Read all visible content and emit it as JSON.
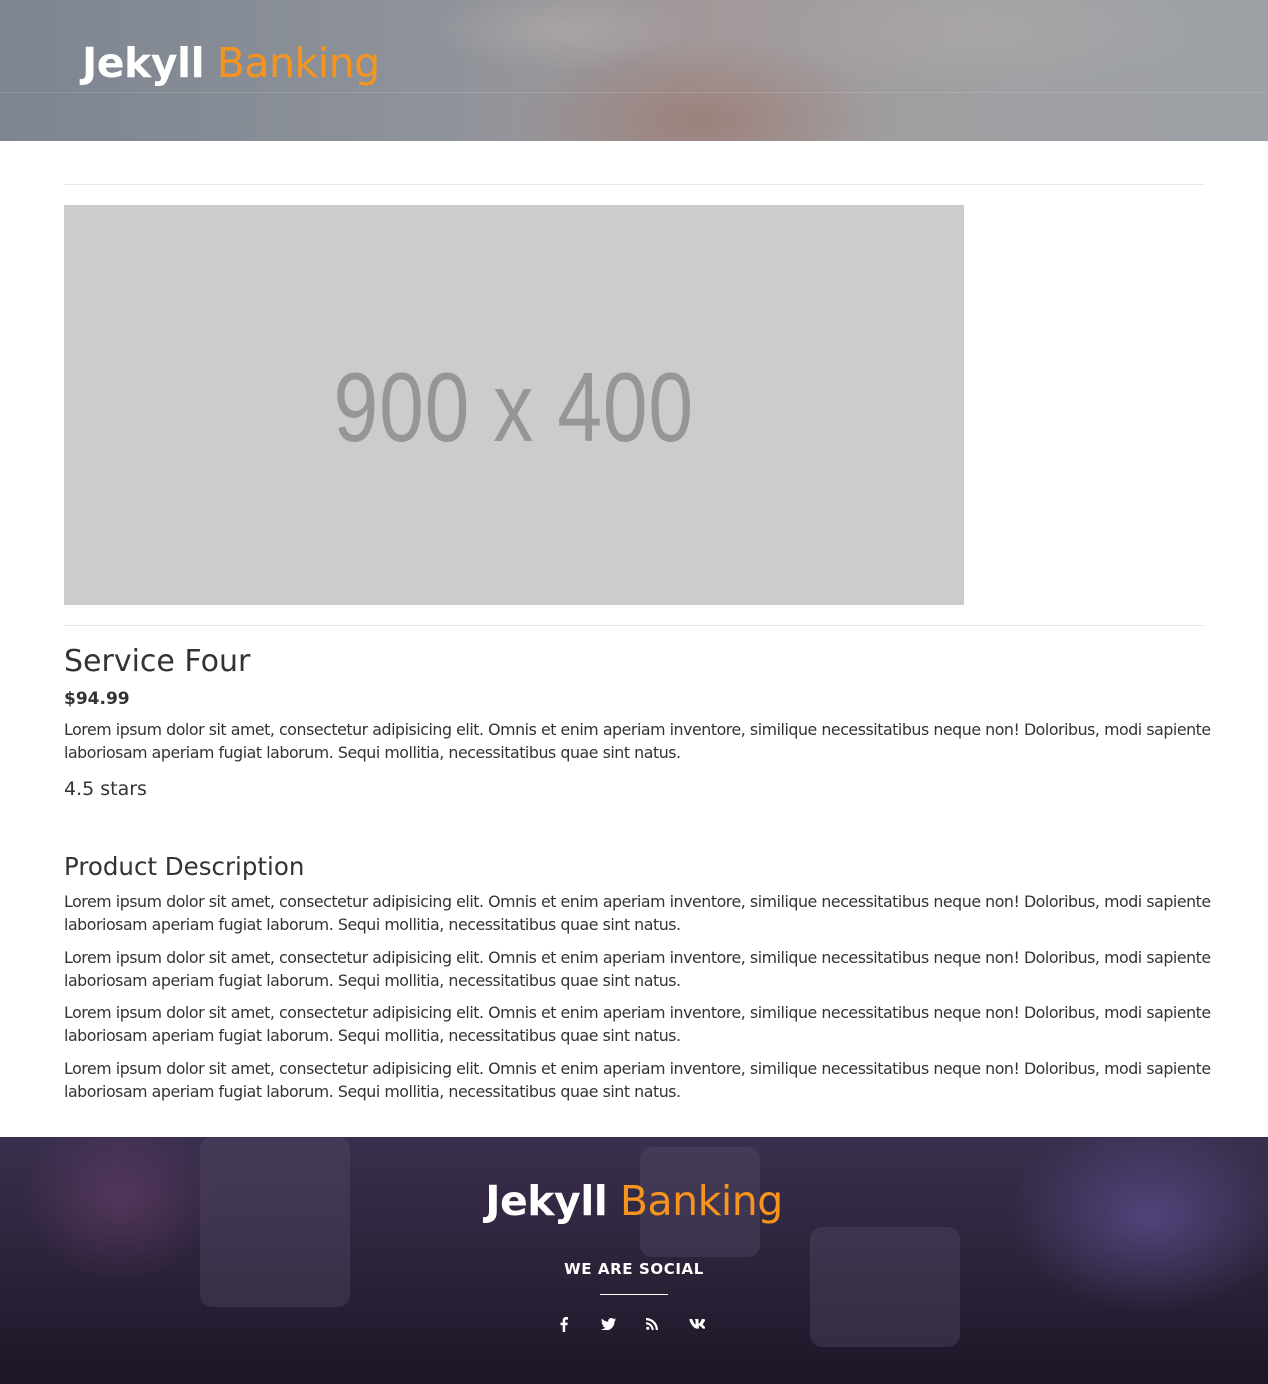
{
  "header": {
    "brand_primary": "Jekyll",
    "brand_secondary": "Banking"
  },
  "product": {
    "image_placeholder": "900 x 400",
    "title": "Service Four",
    "price": "$94.99",
    "summary": "Lorem ipsum dolor sit amet, consectetur adipisicing elit. Omnis et enim aperiam inventore, similique necessitatibus neque non! Doloribus, modi sapiente laboriosam aperiam fugiat laborum. Sequi mollitia, necessitatibus quae sint natus.",
    "rating": "4.5 stars"
  },
  "description": {
    "heading": "Product Description",
    "paragraphs": [
      "Lorem ipsum dolor sit amet, consectetur adipisicing elit. Omnis et enim aperiam inventore, similique necessitatibus neque non! Doloribus, modi sapiente laboriosam aperiam fugiat laborum. Sequi mollitia, necessitatibus quae sint natus.",
      "Lorem ipsum dolor sit amet, consectetur adipisicing elit. Omnis et enim aperiam inventore, similique necessitatibus neque non! Doloribus, modi sapiente laboriosam aperiam fugiat laborum. Sequi mollitia, necessitatibus quae sint natus.",
      "Lorem ipsum dolor sit amet, consectetur adipisicing elit. Omnis et enim aperiam inventore, similique necessitatibus neque non! Doloribus, modi sapiente laboriosam aperiam fugiat laborum. Sequi mollitia, necessitatibus quae sint natus.",
      "Lorem ipsum dolor sit amet, consectetur adipisicing elit. Omnis et enim aperiam inventore, similique necessitatibus neque non! Doloribus, modi sapiente laboriosam aperiam fugiat laborum. Sequi mollitia, necessitatibus quae sint natus."
    ]
  },
  "footer": {
    "brand_primary": "Jekyll",
    "brand_secondary": "Banking",
    "social_title": "WE ARE SOCIAL",
    "social_icons": [
      "facebook-icon",
      "twitter-icon",
      "rss-icon",
      "vk-icon"
    ]
  },
  "colors": {
    "accent": "#f7941d",
    "text": "#333333",
    "placeholder_bg": "#cccccc",
    "placeholder_text": "#969696"
  }
}
